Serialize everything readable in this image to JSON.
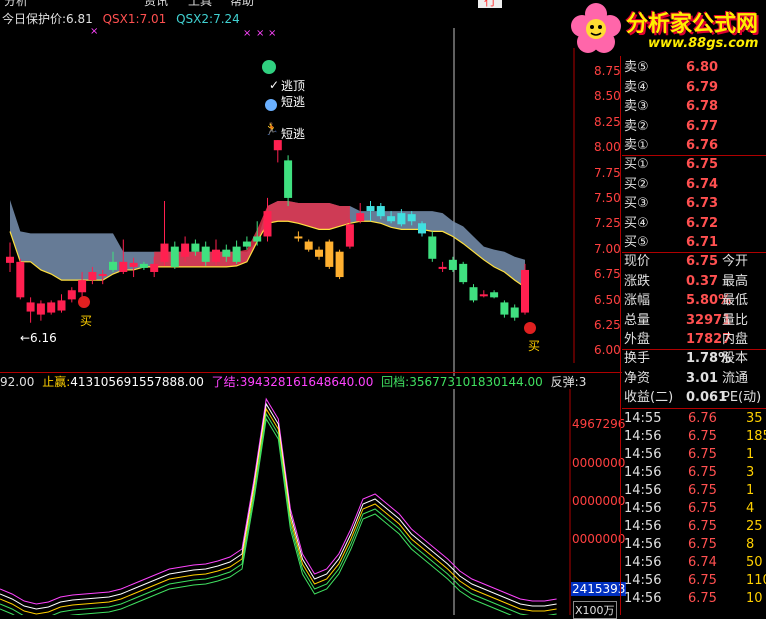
{
  "menu": [
    "分析",
    "",
    "资讯",
    "工具",
    "帮助",
    "行",
    "情"
  ],
  "watermark": {
    "brand": "分析家公式网",
    "url": "www.88gs.com"
  },
  "top_status": {
    "label1": "今日保护价:",
    "value1": "6.81",
    "label2": "QSX1:",
    "value2": "7.01",
    "label3": "QSX2:",
    "value3": "7.24"
  },
  "annotations": {
    "escape_top": "逃顶",
    "short_escape_1": "短逃",
    "short_escape_2": "短逃",
    "buy_1": "买",
    "buy_2": "买",
    "low_marker": "←6.16"
  },
  "price_axis": [
    "8.75",
    "8.50",
    "8.25",
    "8.00",
    "7.75",
    "7.50",
    "7.25",
    "7.00",
    "6.75",
    "6.50",
    "6.25",
    "6.00"
  ],
  "indicator_bar": {
    "prefix": "92.00",
    "label_stop": "止赢:",
    "value_stop": "413105691557888.00",
    "label_exit": "了结:",
    "value_exit": "394328161648640.00",
    "label_pull": "回档:",
    "value_pull": "356773101830144.00",
    "label_bounce": "反弹:",
    "value_bounce": "3"
  },
  "indicator_axis": [
    "4967296",
    "0000000",
    "0000000",
    "0000000"
  ],
  "indicator_readout": "2415393",
  "indicator_unit": "X100万",
  "sell_levels": [
    {
      "name": "卖⑤",
      "price": "6.80"
    },
    {
      "name": "卖④",
      "price": "6.79"
    },
    {
      "name": "卖③",
      "price": "6.78"
    },
    {
      "name": "卖②",
      "price": "6.77"
    },
    {
      "name": "卖①",
      "price": "6.76"
    }
  ],
  "buy_levels": [
    {
      "name": "买①",
      "price": "6.75"
    },
    {
      "name": "买②",
      "price": "6.74"
    },
    {
      "name": "买③",
      "price": "6.73"
    },
    {
      "name": "买④",
      "price": "6.72"
    },
    {
      "name": "买⑤",
      "price": "6.71"
    }
  ],
  "stats": [
    {
      "name": "现价",
      "value": "6.75",
      "extra": "今开"
    },
    {
      "name": "涨跌",
      "value": "0.37",
      "extra": "最高"
    },
    {
      "name": "涨幅",
      "value": "5.80%",
      "extra": "最低"
    },
    {
      "name": "总量",
      "value": "32971",
      "extra": "量比"
    },
    {
      "name": "外盘",
      "value": "17827",
      "extra": "内盘"
    }
  ],
  "stats2": [
    {
      "name": "换手",
      "value": "1.78%",
      "extra": "股本"
    },
    {
      "name": "净资",
      "value": "3.01",
      "extra": "流通"
    },
    {
      "name": "收益(二)",
      "value": "0.061",
      "extra": "PE(动)"
    }
  ],
  "ticks": [
    {
      "time": "14:55",
      "price": "6.76",
      "vol": "35"
    },
    {
      "time": "14:56",
      "price": "6.75",
      "vol": "185"
    },
    {
      "time": "14:56",
      "price": "6.75",
      "vol": "1"
    },
    {
      "time": "14:56",
      "price": "6.75",
      "vol": "3"
    },
    {
      "time": "14:56",
      "price": "6.75",
      "vol": "1"
    },
    {
      "time": "14:56",
      "price": "6.75",
      "vol": "4"
    },
    {
      "time": "14:56",
      "price": "6.75",
      "vol": "25"
    },
    {
      "time": "14:56",
      "price": "6.75",
      "vol": "8"
    },
    {
      "time": "14:56",
      "price": "6.74",
      "vol": "50"
    },
    {
      "time": "14:56",
      "price": "6.75",
      "vol": "110"
    },
    {
      "time": "14:56",
      "price": "6.75",
      "vol": "10"
    }
  ],
  "colors": {
    "up": "#ff3030",
    "down": "#40e0a0",
    "cloud": "#7890b0",
    "cloud_red": "#e0304a"
  }
}
